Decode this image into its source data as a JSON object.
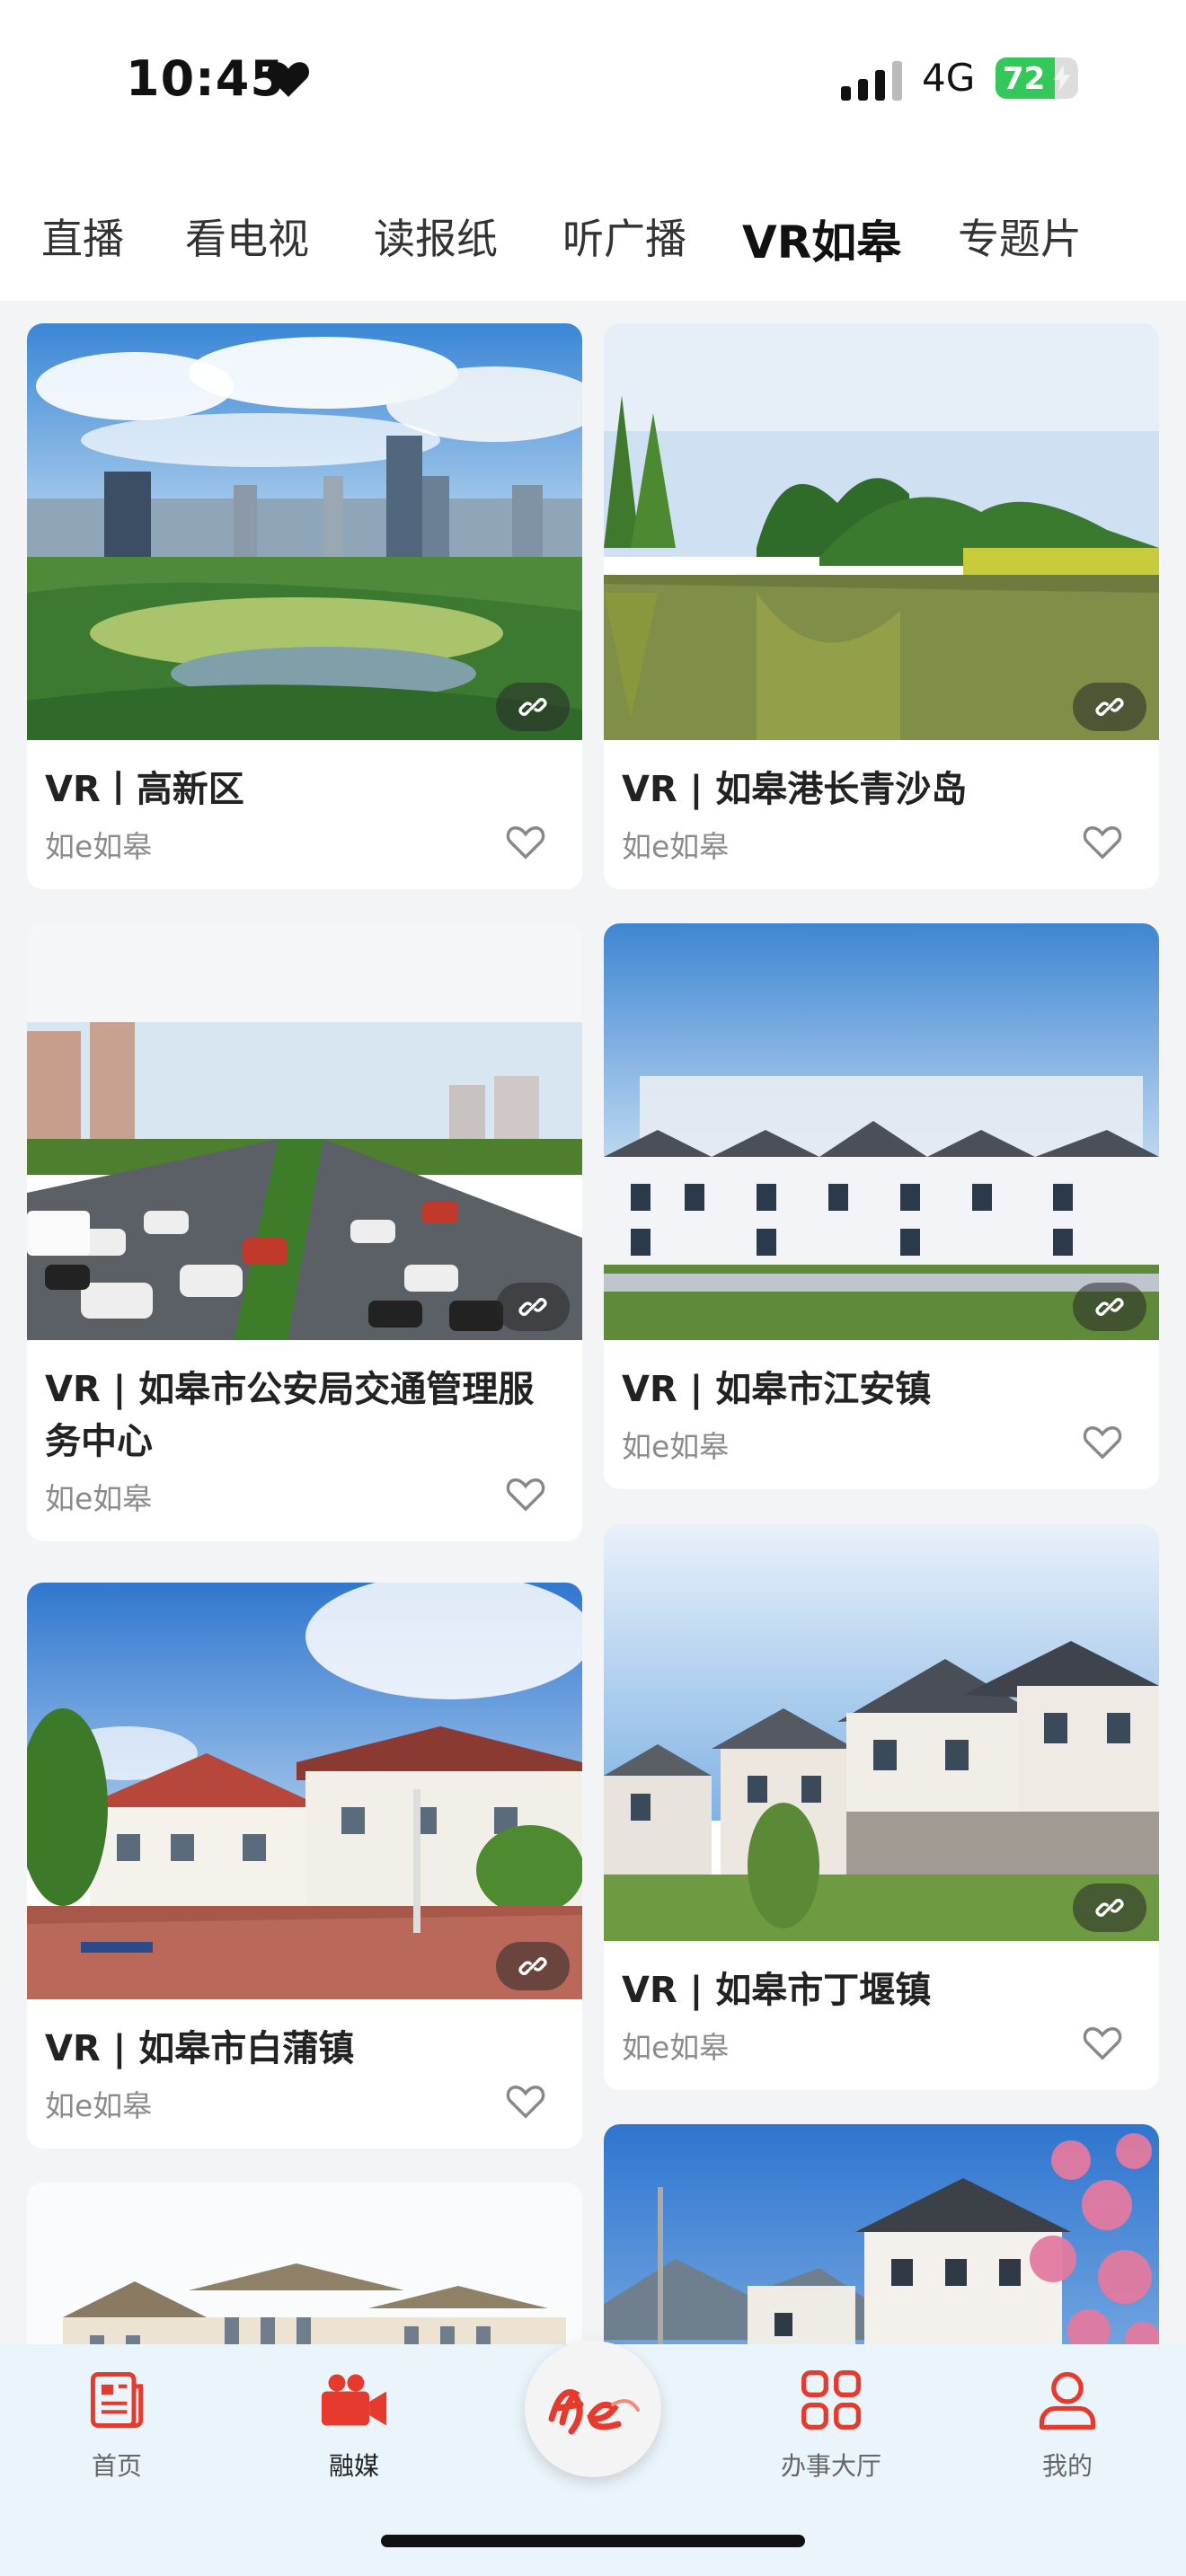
{
  "status": {
    "time": "10:45",
    "network": "4G",
    "battery_level": 72,
    "battery_text": "72"
  },
  "tabs": [
    {
      "label": "直播",
      "active": false
    },
    {
      "label": "看电视",
      "active": false
    },
    {
      "label": "读报纸",
      "active": false
    },
    {
      "label": "听广播",
      "active": false
    },
    {
      "label": "VR如皋",
      "active": true
    },
    {
      "label": "专题片",
      "active": false
    }
  ],
  "cards": [
    {
      "title": "VR丨高新区",
      "source": "如e如皋",
      "image": "city-skyline-park",
      "link_icon": "link-icon",
      "like_icon": "heart-outline-icon"
    },
    {
      "title": "VR | 如皋港长青沙岛",
      "source": "如e如皋",
      "image": "lake-trees",
      "link_icon": "link-icon",
      "like_icon": "heart-outline-icon"
    },
    {
      "title": "VR | 如皋市公安局交通管理服务中心",
      "source": "如e如皋",
      "image": "highway-traffic",
      "link_icon": "link-icon",
      "like_icon": "heart-outline-icon"
    },
    {
      "title": "VR | 如皋市江安镇",
      "source": "如e如皋",
      "image": "white-townhouses",
      "link_icon": "link-icon",
      "like_icon": "heart-outline-icon"
    },
    {
      "title": "VR | 如皋市白蒲镇",
      "source": "如e如皋",
      "image": "house-basketball-court",
      "link_icon": "link-icon",
      "like_icon": "heart-outline-icon"
    },
    {
      "title": "VR | 如皋市丁堰镇",
      "source": "如e如皋",
      "image": "village-houses",
      "link_icon": "link-icon",
      "like_icon": "heart-outline-icon"
    },
    {
      "image": "european-buildings"
    },
    {
      "image": "village-blossom"
    }
  ],
  "bottom_nav": [
    {
      "label": "首页",
      "icon": "news-page-icon",
      "active": false
    },
    {
      "label": "融媒",
      "icon": "video-camera-icon",
      "active": true
    },
    {
      "label": "",
      "icon": "rue-logo-icon",
      "active": false
    },
    {
      "label": "办事大厅",
      "icon": "grid-apps-icon",
      "active": false
    },
    {
      "label": "我的",
      "icon": "user-icon",
      "active": false
    }
  ],
  "colors": {
    "accent": "#e63a2e",
    "battery": "#34c759",
    "nav_bg": "#eaf5fb"
  }
}
